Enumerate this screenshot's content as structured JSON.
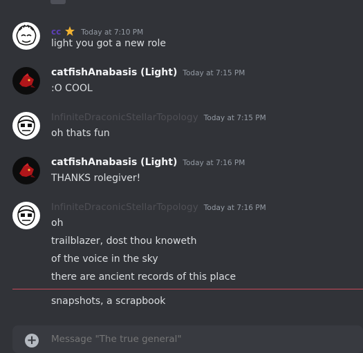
{
  "messages": [
    {
      "author": "cc",
      "timestamp": "Today at 7:10 PM",
      "badge_icon": "star-icon",
      "lines": [
        "light you got a new role"
      ]
    },
    {
      "author": "catfishAnabasis (Light)",
      "timestamp": "Today at 7:15 PM",
      "lines": [
        ":O COOL"
      ]
    },
    {
      "author": "InfiniteDraconicStellarTopology",
      "timestamp": "Today at 7:15 PM",
      "lines": [
        "oh thats fun"
      ]
    },
    {
      "author": "catfishAnabasis (Light)",
      "timestamp": "Today at 7:16 PM",
      "lines": [
        "THANKS rolegiver!"
      ]
    },
    {
      "author": "InfiniteDraconicStellarTopology",
      "timestamp": "Today at 7:16 PM",
      "lines": [
        "oh",
        "trailblazer, dost thou knoweth",
        "of the voice in the sky",
        "there are ancient records of this place",
        "snapshots, a scrapbook"
      ]
    }
  ],
  "composer": {
    "placeholder": "Message \"The true general\""
  },
  "colors": {
    "background": "#313338",
    "new_messages_divider": "#c94a5b",
    "cc_name": "#5b3fb4"
  }
}
